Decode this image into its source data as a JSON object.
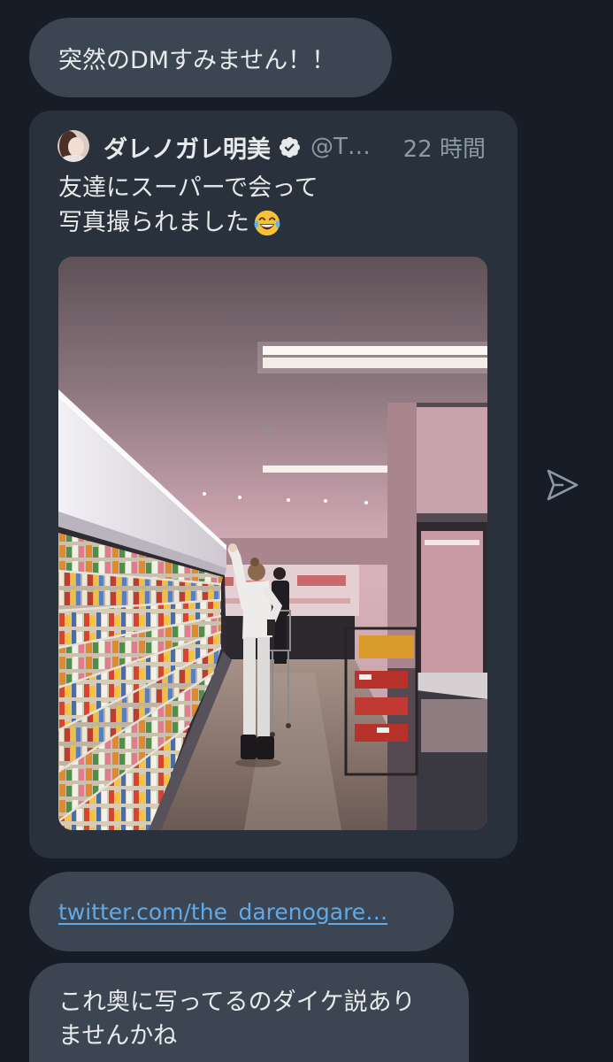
{
  "colors": {
    "background": "#161d26",
    "message_bubble": "#3b4652",
    "tweet_card": "#29323c",
    "primary_text": "#e7e9ea",
    "secondary_text": "#8b98a5",
    "link": "#62a9e8"
  },
  "message_1": {
    "text": "突然のDMすみません！！"
  },
  "shared_tweet": {
    "author_name": "ダレノガレ明美",
    "verified_icon": "verified-badge-icon",
    "handle": "@T…",
    "timestamp": "22 時間",
    "text_lines": [
      "友達にスーパーで会って",
      "写真撮られました"
    ],
    "text_emoji_icon": "face-with-tears-of-joy-icon"
  },
  "message_link": {
    "text": "twitter.com/the_darenogare…"
  },
  "message_last": {
    "lines": [
      "これ奥に写ってるのダイケ説あり",
      "ませんかね"
    ]
  },
  "icons": {
    "send": "send-icon"
  }
}
